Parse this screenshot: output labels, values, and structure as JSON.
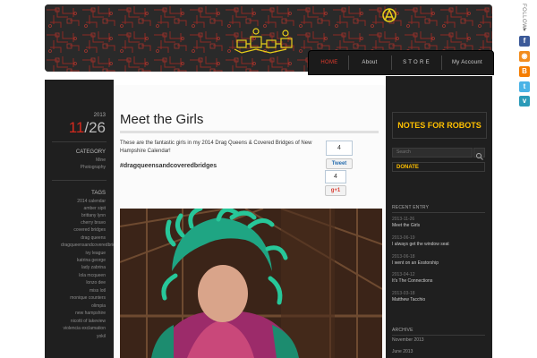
{
  "header": {
    "nav": [
      {
        "label": "HOME",
        "active": true
      },
      {
        "label": "About",
        "active": false
      },
      {
        "label": "S T O R E",
        "active": false
      },
      {
        "label": "My Account",
        "active": false
      }
    ]
  },
  "follow": {
    "label": "FOLLOW",
    "icons": [
      "facebook-icon",
      "rss-icon",
      "blogger-icon",
      "twitter-icon",
      "vimeo-icon"
    ]
  },
  "left": {
    "date_year": "2013",
    "date_month": "11",
    "date_sep": "/",
    "date_day": "26",
    "category_heading": "CATEGORY",
    "categories": [
      "Mine",
      "Photography"
    ],
    "tags_heading": "TAGS",
    "tags": [
      "2014 calendar",
      "amber sipit",
      "brittany lynn",
      "cherry bravo",
      "covered bridges",
      "drag queens",
      "dragqueensandcoveredbridges",
      "ivy league",
      "katrina george",
      "lady zabrina",
      "lola mcqueen",
      "lonzo dee",
      "miss lotl",
      "monique counters",
      "olimpia",
      "new hampshire",
      "nicotti of lakeview",
      "violencia exclamation",
      "yokil"
    ]
  },
  "post": {
    "title": "Meet the Girls",
    "intro": "These are the fantastic girls in my 2014 Drag Queens & Covered Bridges of New Hampshire Calendar!",
    "hashtag": "#dragqueensandcoveredbridges",
    "tweet_count": "4",
    "tweet_label": "Tweet",
    "plus_count": "4",
    "plus_label": "g+1"
  },
  "right": {
    "notes_title": "NOTES FOR ROBOTS",
    "search_placeholder": "Search",
    "donate_label": "DONATE",
    "recent_heading": "RECENT ENTRY",
    "recent": [
      {
        "date": "2013-11-26",
        "title": "Meet the Girls"
      },
      {
        "date": "2013-06-19",
        "title": "I always get the window seat"
      },
      {
        "date": "2013-06-18",
        "title": "I went on an Exstorship"
      },
      {
        "date": "2013-04-12",
        "title": "It's The Connections"
      },
      {
        "date": "2013-03-18",
        "title": "Matthew Tacchio"
      }
    ],
    "archive_heading": "ARCHIVE",
    "archive": [
      "November 2013",
      "June 2013"
    ]
  },
  "colors": {
    "accent_red": "#d42a1e",
    "accent_yellow": "#ffc000",
    "panel_dark": "#1f1f1f"
  }
}
